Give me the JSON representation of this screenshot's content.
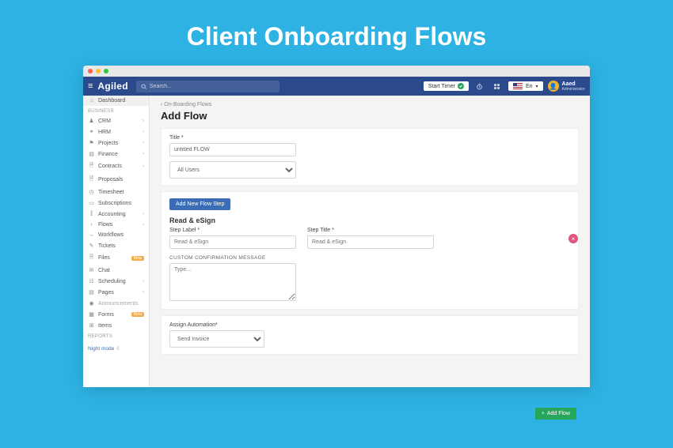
{
  "hero": {
    "title": "Client Onboarding Flows"
  },
  "brand": "Agiled",
  "search": {
    "placeholder": "Search..."
  },
  "topbar": {
    "start_timer": "Start Timer",
    "lang": "En",
    "user_name": "Aaed",
    "user_role": "Administrator"
  },
  "sidebar": {
    "dashboard": "Dashboard",
    "sections": {
      "business": "Business",
      "reports": "Reports"
    },
    "items": {
      "crm": "CRM",
      "hrm": "HRM",
      "projects": "Projects",
      "finance": "Finance",
      "contracts": "Contracts",
      "proposals": "Proposals",
      "timesheet": "Timesheet",
      "subscriptions": "Subscriptions",
      "accounting": "Accounting",
      "flows": "Flows",
      "workflows": "Workflows",
      "tickets": "Tickets",
      "files": "Files",
      "chat": "Chat",
      "scheduling": "Scheduling",
      "pages": "Pages",
      "announcements": "Announcements",
      "forms": "Forms",
      "items_": "Items"
    },
    "beta": "Beta",
    "night_mode": "Night mode"
  },
  "main": {
    "breadcrumb": "On-Boarding Flows",
    "page_title": "Add Flow",
    "title_label": "Title *",
    "title_value": "untitled FLOW",
    "users_select": "All Users",
    "add_step_btn": "Add New Flow Step",
    "step": {
      "heading": "Read & eSign",
      "label_lbl": "Step Label *",
      "label_ph": "Read & eSign",
      "title_lbl": "Step Title *",
      "title_ph": "Read & eSign",
      "confirm_lbl": "Custom Confirmation Message",
      "confirm_ph": "Type..."
    },
    "automation_lbl": "Assign Automation*",
    "automation_val": "Send Invoice",
    "add_flow_btn": "Add Flow"
  }
}
